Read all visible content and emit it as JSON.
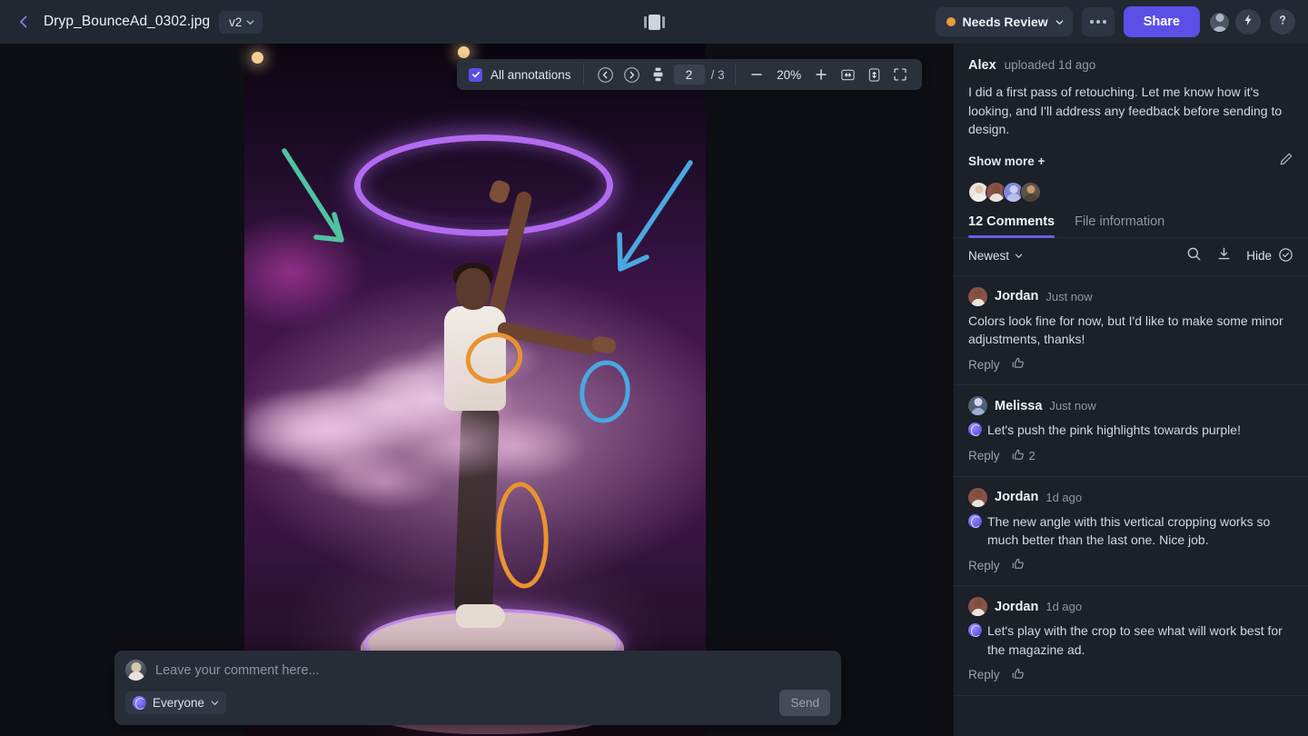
{
  "header": {
    "back_icon": "chevron-left-icon",
    "file_name": "Dryp_BounceAd_0302.jpg",
    "version_label": "v2",
    "compare_icon": "compare-view-icon",
    "status_label": "Needs Review",
    "status_color": "#e89b3c",
    "more_label": "...",
    "share_label": "Share",
    "account_icon": "account-avatar-icon",
    "lightning_icon": "lightning-bolt-icon",
    "help_icon": "question-mark-icon",
    "accent_color": "#5b4fe8"
  },
  "toolbar": {
    "annotations_label": "All annotations",
    "annotations_checked": true,
    "prev_icon": "chevron-left-circle-icon",
    "next_icon": "chevron-right-circle-icon",
    "pages_icon": "page-list-icon",
    "page_current": "2",
    "page_total": "/ 3",
    "zoom_out_label": "—",
    "zoom_value": "20%",
    "zoom_in_label": "+",
    "fit_width_icon": "fit-width-icon",
    "fit_height_icon": "fit-height-icon",
    "fullscreen_icon": "fullscreen-icon"
  },
  "composer": {
    "placeholder": "Leave your comment here...",
    "audience_label": "Everyone",
    "audience_icon": "globe-icon",
    "send_label": "Send"
  },
  "panel": {
    "description": {
      "author": "Alex",
      "meta": "uploaded 1d ago",
      "body": "I did a first pass of retouching. Let me know how it's looking, and I'll address any feedback before sending to design.",
      "show_more_label": "Show more +",
      "edit_icon": "pencil-edit-icon"
    },
    "collaborators": [
      {
        "name": "collaborator-1",
        "bg": "#e8e4df",
        "skin": "#e3c6ab",
        "body": "#f3f0ec"
      },
      {
        "name": "collaborator-2",
        "bg": "#8a524a",
        "skin": "#7d4f35",
        "body": "#e9e5de"
      },
      {
        "name": "collaborator-3",
        "bg": "#7f87d8",
        "skin": "#c9cdf0",
        "body": "#b9bfe8"
      },
      {
        "name": "collaborator-4",
        "bg": "#5d5348",
        "skin": "#c79a72",
        "body": "#4b4238"
      }
    ],
    "tabs": [
      {
        "label": "12 Comments",
        "active": true
      },
      {
        "label": "File information",
        "active": false
      }
    ],
    "sort": {
      "selected": "Newest",
      "chevron_icon": "chevron-down-icon",
      "search_icon": "search-icon",
      "download_icon": "download-icon",
      "hide_label": "Hide",
      "hide_icon": "check-circle-icon"
    },
    "comments": [
      {
        "author": "Jordan",
        "time": "Just now",
        "text": "Colors look fine for now, but I'd like to make some minor adjustments, thanks!",
        "has_pin": false,
        "reply_label": "Reply",
        "like_count": "",
        "avatar_bg": "#8a524a",
        "avatar_skin": "#7d4f35",
        "avatar_body": "#e9e5de"
      },
      {
        "author": "Melissa",
        "time": "Just now",
        "text": "Let's push the pink highlights towards purple!",
        "has_pin": true,
        "reply_label": "Reply",
        "like_count": "2",
        "avatar_bg": "#4f5f78",
        "avatar_skin": "#cfd6ea",
        "avatar_body": "#9fb0cf"
      },
      {
        "author": "Jordan",
        "time": "1d ago",
        "text": "The new angle with this vertical cropping works so much better than the last one. Nice job.",
        "has_pin": true,
        "reply_label": "Reply",
        "like_count": "",
        "avatar_bg": "#8a524a",
        "avatar_skin": "#7d4f35",
        "avatar_body": "#e9e5de"
      },
      {
        "author": "Jordan",
        "time": "1d ago",
        "text": "Let's play with the crop to see what will work best for the magazine ad.",
        "has_pin": true,
        "reply_label": "Reply",
        "like_count": "",
        "avatar_bg": "#8a524a",
        "avatar_skin": "#7d4f35",
        "avatar_body": "#e9e5de"
      }
    ]
  },
  "annotations": {
    "arrow_teal_color": "#4fc3a1",
    "arrow_blue_color": "#4aa8e0",
    "ellipse_orange_color": "#e8932e",
    "ellipse_blue_color": "#4aa8e0",
    "items": [
      {
        "name": "teal-arrow-annotation",
        "type": "arrow"
      },
      {
        "name": "blue-arrow-annotation",
        "type": "arrow"
      },
      {
        "name": "orange-ellipse-shoulder-annotation",
        "type": "ellipse"
      },
      {
        "name": "blue-ellipse-hand-annotation",
        "type": "ellipse"
      },
      {
        "name": "orange-ellipse-leg-annotation",
        "type": "ellipse"
      }
    ]
  }
}
